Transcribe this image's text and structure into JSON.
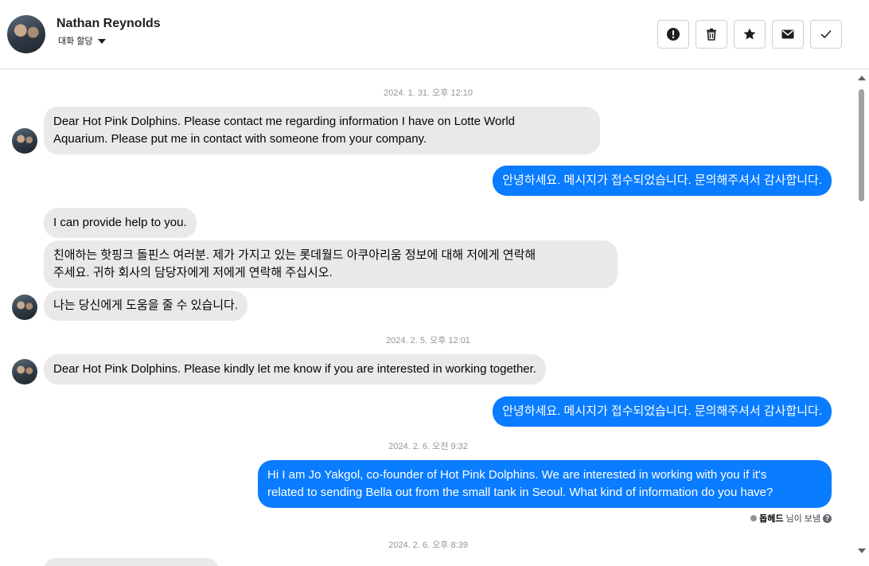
{
  "header": {
    "name": "Nathan Reynolds",
    "assign_label": "대화 할당",
    "actions": [
      {
        "icon": "exclamation-icon"
      },
      {
        "icon": "trash-icon"
      },
      {
        "icon": "star-icon"
      },
      {
        "icon": "envelope-icon"
      },
      {
        "icon": "check-icon"
      }
    ]
  },
  "thread": {
    "ts1": "2024. 1. 31. 오후 12:10",
    "msg1": "Dear Hot Pink Dolphins.  Please contact me regarding information I have on Lotte World\nAquarium.  Please put me in contact with someone from your company.",
    "reply1": "안녕하세요. 메시지가 접수되었습니다. 문의해주셔서 감사합니다.",
    "msg2": "I can provide help to you.",
    "msg3": "친애하는 핫핑크 돌핀스 여러분. 제가 가지고 있는 롯데월드 아쿠아리움 정보에 대해 저에게 연락해\n주세요. 귀하 회사의 담당자에게 저에게 연락해 주십시오.",
    "msg4": "나는 당신에게 도움을 줄 수 있습니다.",
    "ts2": "2024. 2. 5. 오후 12:01",
    "msg5": "Dear Hot Pink Dolphins.  Please kindly let me know if you are interested in working together.",
    "reply2": "안녕하세요. 메시지가 접수되었습니다. 문의해주셔서 감사합니다.",
    "ts3": "2024. 2. 6. 오전 9:32",
    "reply3": "Hi I am Jo Yakgol, co-founder of Hot Pink Dolphins. We are interested in working with you if it's\nrelated to sending Bella out from the small tank in Seoul. What kind of information do you have?",
    "sent_by_name": "돕헤드",
    "sent_by_suffix": "님이 보냄",
    "ts4": "2024. 2. 6. 오후 8:39"
  }
}
